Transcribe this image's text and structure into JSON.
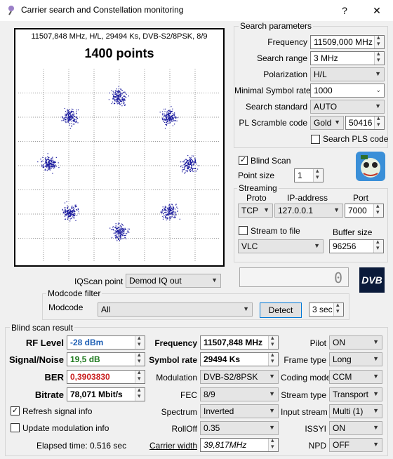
{
  "window": {
    "title": "Carrier search and Constellation monitoring",
    "help": "?",
    "close": "✕"
  },
  "plot": {
    "info": "11507,848 MHz, H/L, 29494 Ks, DVB-S2/8PSK, 8/9",
    "points": "1400 points"
  },
  "chart_data": {
    "type": "scatter",
    "title": "1400 points",
    "grid": true,
    "clusters": [
      {
        "x": 0,
        "y": 1
      },
      {
        "x": 0.7071,
        "y": 0.7071
      },
      {
        "x": 1,
        "y": 0
      },
      {
        "x": 0.7071,
        "y": -0.7071
      },
      {
        "x": 0,
        "y": -1
      },
      {
        "x": -0.7071,
        "y": -0.7071
      },
      {
        "x": -1,
        "y": 0
      },
      {
        "x": -0.7071,
        "y": 0.7071
      }
    ]
  },
  "search": {
    "group": "Search parameters",
    "frequency_label": "Frequency",
    "frequency": "11509,000 MHz",
    "range_label": "Search range",
    "range": "3 MHz",
    "pol_label": "Polarization",
    "pol": "H/L",
    "minsr_label": "Minimal Symbol rate",
    "minsr": "1000",
    "std_label": "Search standard",
    "std": "AUTO",
    "pls_label": "PL Scramble code",
    "pls_mode": "Gold",
    "pls_value": "50416",
    "search_pls": "Search PLS code"
  },
  "blind_scan": {
    "label": "Blind Scan",
    "checked": "✓",
    "point_size_label": "Point size",
    "point_size": "1"
  },
  "streaming": {
    "group": "Streaming",
    "proto_label": "Proto",
    "ip_label": "IP-address",
    "port_label": "Port",
    "proto": "TCP",
    "ip": "127.0.0.1",
    "port": "7000",
    "file_label": "Stream to file",
    "buffer_label": "Buffer size",
    "player": "VLC",
    "buffer": "96256"
  },
  "iq": {
    "label": "IQScan point",
    "value": "Demod IQ out"
  },
  "lcd": "0",
  "dvb_logo": "DVB",
  "modcode": {
    "group": "Modcode filter",
    "label": "Modcode",
    "value": "All",
    "detect": "Detect",
    "time": "3 sec"
  },
  "result": {
    "group": "Blind scan result",
    "rf_label": "RF Level",
    "rf": "-28 dBm",
    "sn_label": "Signal/Noise",
    "sn": "19,5 dB",
    "ber_label": "BER",
    "ber": "0,3903830",
    "bitrate_label": "Bitrate",
    "bitrate": "78,071 Mbit/s",
    "freq_label": "Frequency",
    "freq": "11507,848 MHz",
    "sr_label": "Symbol rate",
    "sr": "29494 Ks",
    "mod_label": "Modulation",
    "mod": "DVB-S2/8PSK",
    "fec_label": "FEC",
    "fec": "8/9",
    "spec_label": "Spectrum",
    "spec": "Inverted",
    "roll_label": "RollOff",
    "roll": "0.35",
    "cw_label": "Carrier width",
    "cw": "39,817MHz",
    "pilot_label": "Pilot",
    "pilot": "ON",
    "frame_label": "Frame type",
    "frame": "Long",
    "coding_label": "Coding mode",
    "coding": "CCM",
    "stype_label": "Stream type",
    "stype": "Transport",
    "istream_label": "Input stream",
    "istream": "Multi (1)",
    "issyi_label": "ISSYI",
    "issyi": "ON",
    "npd_label": "NPD",
    "npd": "OFF",
    "refresh_label": "Refresh signal info",
    "refresh_checked": "✓",
    "update_label": "Update modulation info",
    "elapsed": "Elapsed time: 0.516 sec"
  },
  "colors": {
    "rf": "#1e5fb4",
    "sn": "#1e7a1e",
    "ber": "#c81e1e",
    "dots": "#1a1a9e"
  }
}
